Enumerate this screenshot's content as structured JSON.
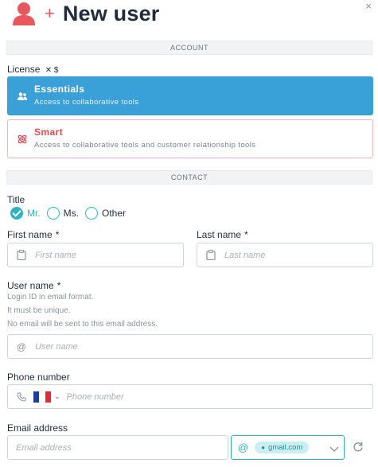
{
  "header": {
    "title": "New user",
    "plus": "+",
    "close": "×"
  },
  "sections": {
    "account": "ACCOUNT",
    "contact": "CONTACT"
  },
  "license": {
    "label": "License",
    "icons": "✕ $",
    "options": [
      {
        "name": "Essentials",
        "description": "Access to collaborative tools",
        "selected": true,
        "icon": "users-icon"
      },
      {
        "name": "Smart",
        "description": "Access to collaborative tools and customer relationship tools",
        "selected": false,
        "icon": "atom-icon"
      }
    ]
  },
  "title_field": {
    "label": "Title",
    "options": [
      {
        "label": "Mr.",
        "checked": true
      },
      {
        "label": "Ms.",
        "checked": false
      },
      {
        "label": "Other",
        "checked": false
      }
    ]
  },
  "first_name": {
    "label": "First name",
    "required": "*",
    "placeholder": "First name"
  },
  "last_name": {
    "label": "Last name",
    "required": "*",
    "placeholder": "Last name"
  },
  "user_name": {
    "label": "User name",
    "required": "*",
    "hints": [
      "Login ID in email format.",
      "It must be unique.",
      "No email will be sent to this email address."
    ],
    "placeholder": "User name"
  },
  "phone": {
    "label": "Phone number",
    "placeholder": "Phone number",
    "country": "FR"
  },
  "email": {
    "label": "Email address",
    "placeholder": "Email address",
    "domain": "gmail.com"
  },
  "colors": {
    "accent": "#3aa0d8",
    "teal": "#2bb5c4",
    "brand_red": "#e8575b"
  }
}
